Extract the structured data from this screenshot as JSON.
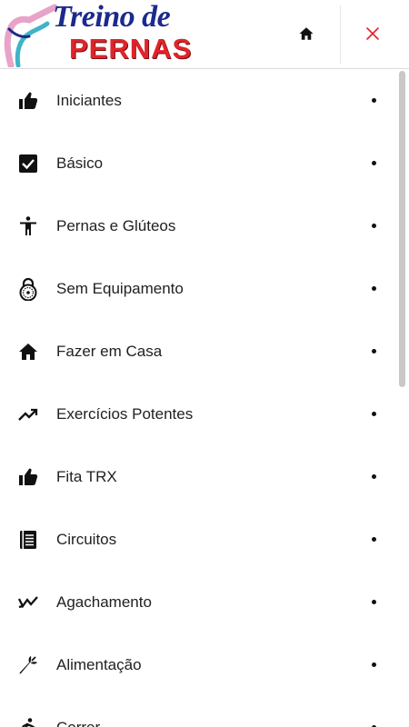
{
  "header": {
    "logo": {
      "title": "Treino de",
      "subtitle": "PERNAS"
    },
    "home_icon": "home-icon",
    "close_icon": "close-icon",
    "accent_close": "#e0242a"
  },
  "menu": {
    "items": [
      {
        "label": "Iniciantes",
        "icon": "thumb-up-icon"
      },
      {
        "label": "Básico",
        "icon": "checkbox-icon"
      },
      {
        "label": "Pernas e Glúteos",
        "icon": "person-icon"
      },
      {
        "label": "Sem Equipamento",
        "icon": "padlock-icon"
      },
      {
        "label": "Fazer em Casa",
        "icon": "home-icon"
      },
      {
        "label": "Exercícios Potentes",
        "icon": "trending-up-icon"
      },
      {
        "label": "Fita TRX",
        "icon": "thumb-up-icon"
      },
      {
        "label": "Circuitos",
        "icon": "list-book-icon"
      },
      {
        "label": "Agachamento",
        "icon": "trending-down-icon"
      },
      {
        "label": "Alimentação",
        "icon": "carrot-icon"
      },
      {
        "label": "Correr",
        "icon": "running-icon"
      }
    ]
  }
}
